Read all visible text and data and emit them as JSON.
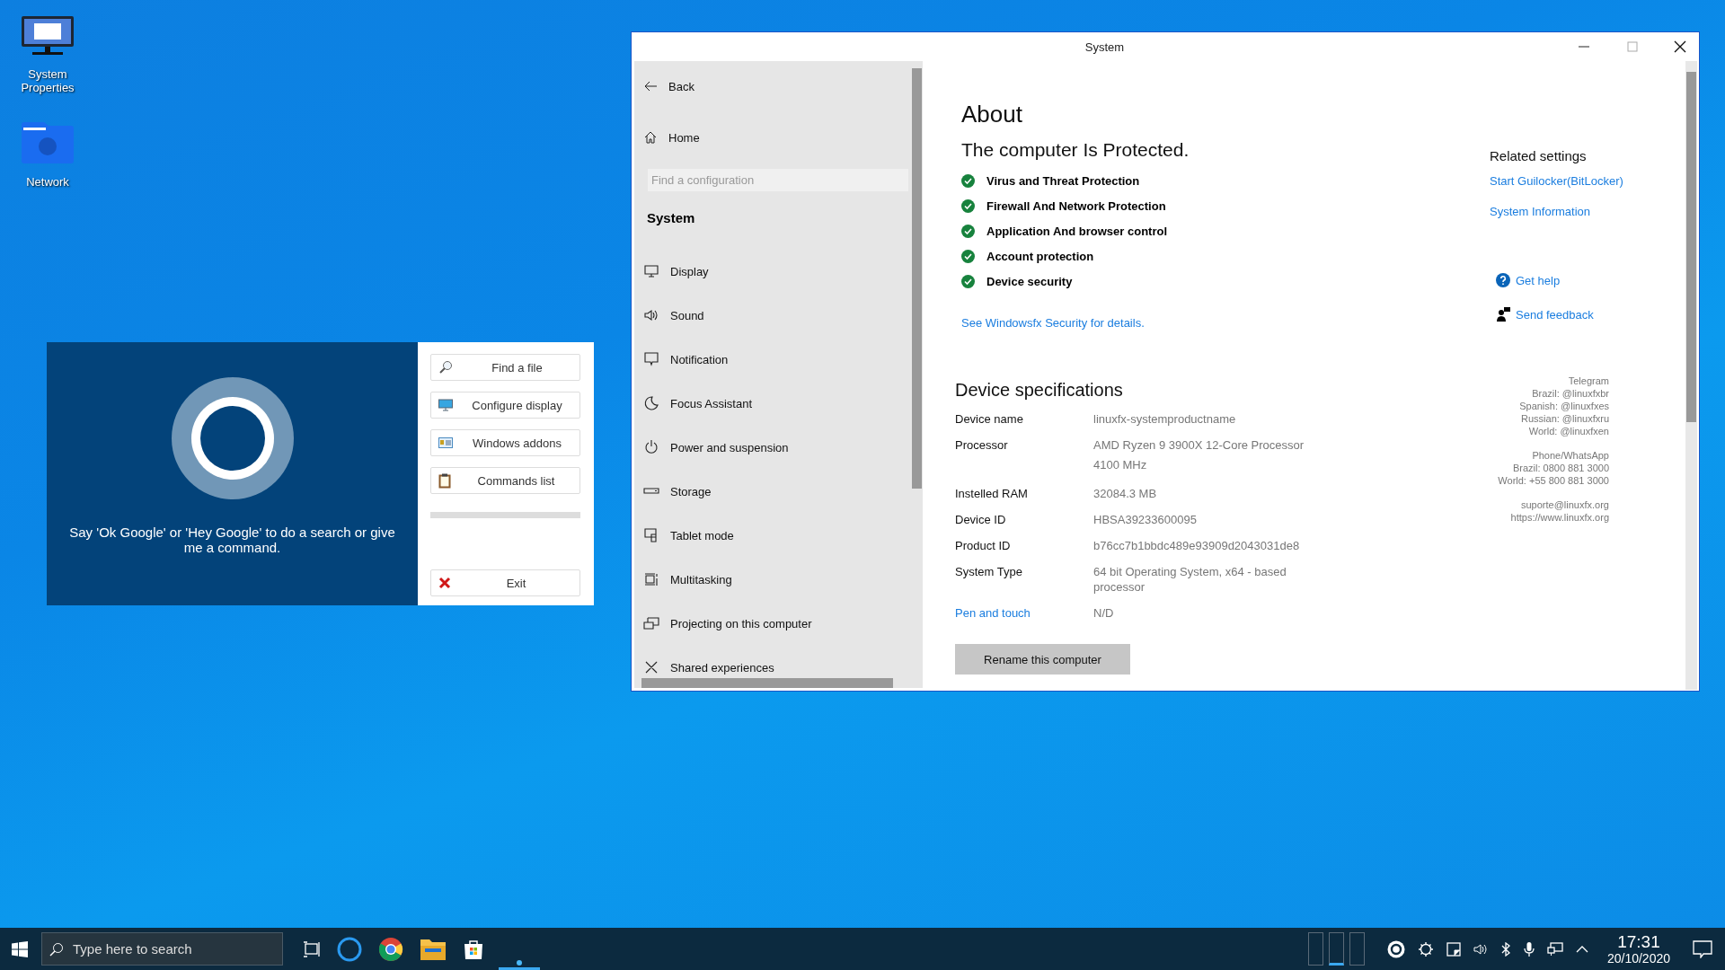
{
  "desktop_icons": [
    {
      "label": "System Properties"
    },
    {
      "label": "Network"
    }
  ],
  "assistant": {
    "prompt": "Say 'Ok Google' or 'Hey Google' to do a search or give me a command.",
    "commands": [
      {
        "label": "Find a file"
      },
      {
        "label": "Configure display"
      },
      {
        "label": "Windows addons"
      },
      {
        "label": "Commands list"
      }
    ],
    "exit": "Exit"
  },
  "window": {
    "title": "System",
    "sidebar": {
      "back": "Back",
      "home": "Home",
      "search_placeholder": "Find a configuration",
      "section": "System",
      "items": [
        {
          "label": "Display"
        },
        {
          "label": "Sound"
        },
        {
          "label": "Notification"
        },
        {
          "label": "Focus Assistant"
        },
        {
          "label": "Power and suspension"
        },
        {
          "label": "Storage"
        },
        {
          "label": "Tablet mode"
        },
        {
          "label": "Multitasking"
        },
        {
          "label": "Projecting on this computer"
        },
        {
          "label": "Shared experiences"
        }
      ]
    },
    "about": {
      "title": "About",
      "status": "The computer Is Protected.",
      "checks": [
        "Virus and Threat Protection",
        "Firewall And Network Protection",
        "Application And browser control",
        "Account protection",
        "Device security"
      ],
      "security_link": "See Windowsfx Security for details.",
      "specs_title": "Device specifications",
      "specs": [
        {
          "kind": "text",
          "label": "Device name",
          "value": "linuxfx-systemproductname"
        },
        {
          "kind": "text",
          "label": "Processor",
          "value": "AMD Ryzen 9 3900X 12-Core Processor 4100 MHz"
        },
        {
          "kind": "text",
          "label": "Instelled RAM",
          "value": "32084.3 MB"
        },
        {
          "kind": "text",
          "label": "Device ID",
          "value": "HBSA39233600095"
        },
        {
          "kind": "text",
          "label": "Product ID",
          "value": "b76cc7b1bbdc489e93909d2043031de8"
        },
        {
          "kind": "text",
          "label": "System Type",
          "value": "64 bit Operating System, x64 - based processor"
        },
        {
          "kind": "link",
          "label": "Pen and touch",
          "value": "N/D"
        }
      ],
      "rename_button": "Rename this computer"
    },
    "related": {
      "title": "Related settings",
      "links": [
        "Start Guilocker(BitLocker)",
        "System Information"
      ],
      "help": "Get help",
      "feedback": "Send feedback",
      "contact": [
        [
          "Telegram",
          "Brazil: @linuxfxbr",
          "Spanish: @linuxfxes",
          "Russian: @linuxfxru",
          "World: @linuxfxen"
        ],
        [
          "Phone/WhatsApp",
          "Brazil: 0800 881 3000",
          "World: +55 800 881 3000"
        ],
        [
          "suporte@linuxfx.org",
          "https://www.linuxfx.org"
        ]
      ]
    }
  },
  "taskbar": {
    "search_placeholder": "Type here to search",
    "time": "17:31",
    "date": "20/10/2020"
  }
}
